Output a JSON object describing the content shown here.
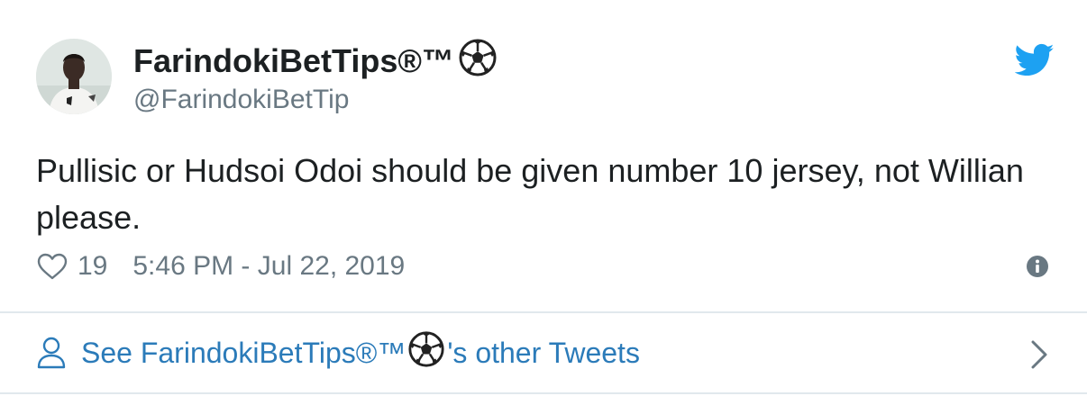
{
  "tweet": {
    "display_name": "FarindokiBetTips®™",
    "display_name_emoji": "soccer-ball-emoji",
    "handle": "@FarindokiBetTip",
    "text": "Pullisic or Hudsoi Odoi should be given number 10 jersey, not Willian please.",
    "like_count": "19",
    "timestamp": "5:46 PM - Jul 22, 2019"
  },
  "footer": {
    "other_tweets_prefix": "See FarindokiBetTips®™",
    "other_tweets_suffix": "'s other Tweets"
  },
  "icons": {
    "brand": "twitter-bird-icon",
    "like": "heart-icon",
    "info": "info-icon",
    "profile": "person-icon",
    "chevron": "chevron-right-icon"
  },
  "colors": {
    "text": "#1c2022",
    "secondary_text": "#697882",
    "link": "#2b7bb9",
    "twitter_blue": "#1da1f2",
    "divider": "#e1e8ed"
  }
}
